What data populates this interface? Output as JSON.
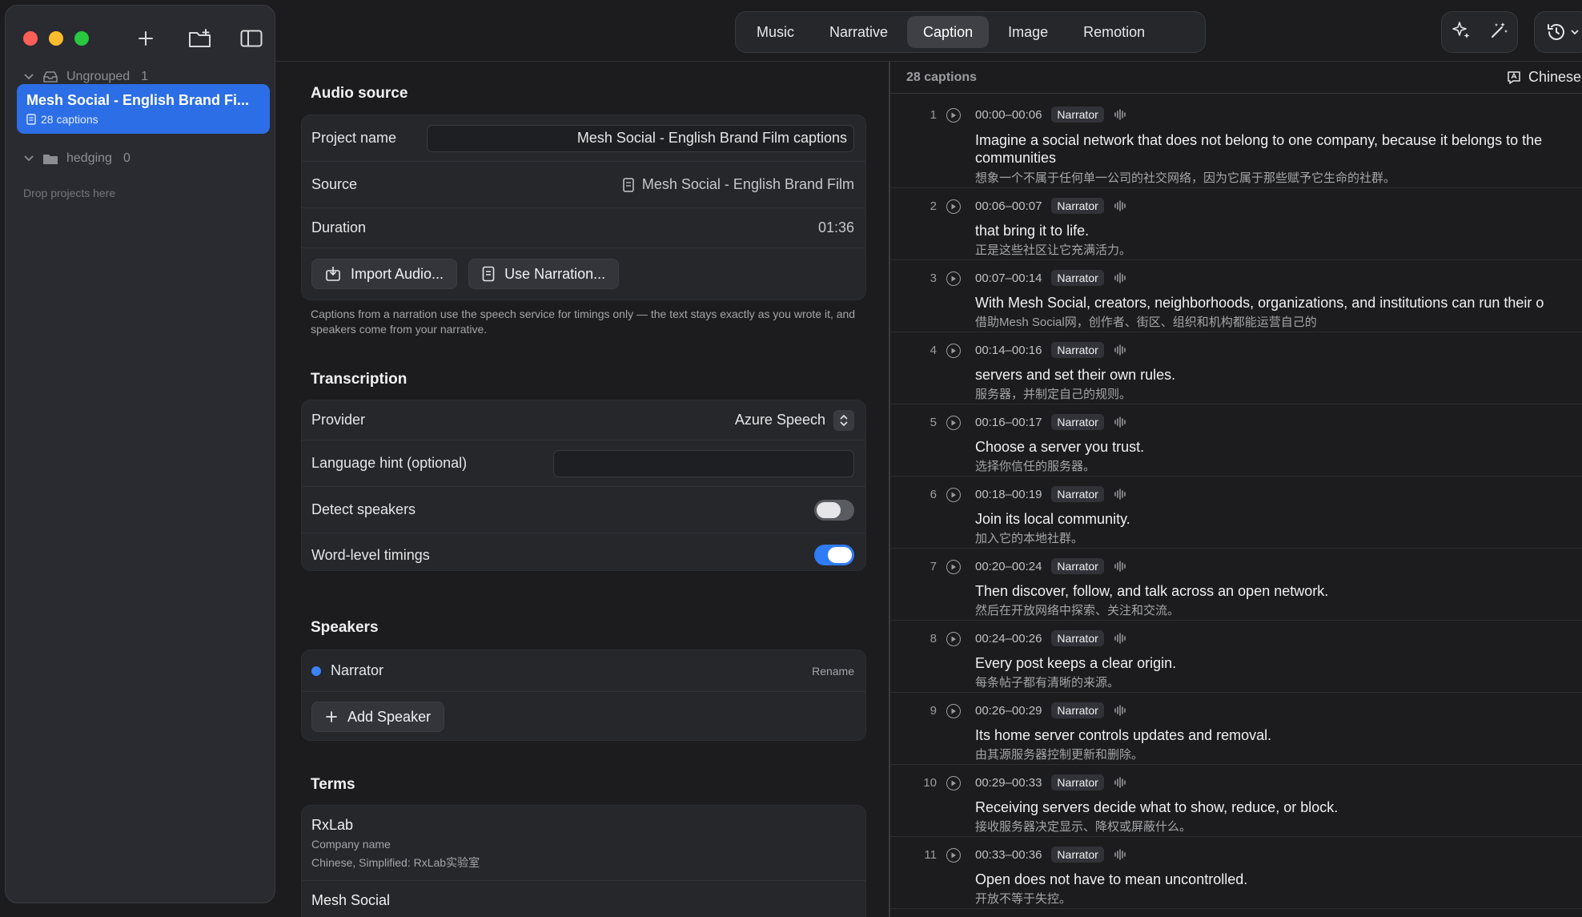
{
  "sidebar": {
    "groups": [
      {
        "name": "Ungrouped",
        "count": "1"
      },
      {
        "name": "hedging",
        "count": "0"
      }
    ],
    "project": {
      "title": "Mesh Social - English Brand Fi...",
      "subtitle": "28 captions"
    },
    "drop_hint": "Drop projects here"
  },
  "toolbar": {
    "tabs": [
      {
        "label": "Music"
      },
      {
        "label": "Narrative"
      },
      {
        "label": "Caption"
      },
      {
        "label": "Image"
      },
      {
        "label": "Remotion"
      }
    ],
    "active_tab": "Caption"
  },
  "audio": {
    "title": "Audio source",
    "project_name_label": "Project name",
    "project_name_value": "Mesh Social - English Brand Film captions",
    "source_label": "Source",
    "source_value": "Mesh Social - English Brand Film",
    "duration_label": "Duration",
    "duration_value": "01:36",
    "import_button": "Import Audio...",
    "narration_button": "Use Narration...",
    "note": "Captions from a narration use the speech service for timings only — the text stays exactly as you wrote it, and speakers come from your narrative."
  },
  "transcription": {
    "title": "Transcription",
    "provider_label": "Provider",
    "provider_value": "Azure Speech",
    "language_label": "Language hint (optional)",
    "language_value": "",
    "detect_label": "Detect speakers",
    "detect_on": false,
    "word_label": "Word-level timings",
    "word_on": true
  },
  "speakers": {
    "title": "Speakers",
    "items": [
      {
        "name": "Narrator",
        "color": "#3b82f6",
        "action": "Rename"
      }
    ],
    "add_button": "Add Speaker"
  },
  "terms": {
    "title": "Terms",
    "items": [
      {
        "name": "RxLab",
        "type": "Company name",
        "translation": "Chinese, Simplified: RxLab实验室"
      },
      {
        "name": "Mesh Social"
      }
    ]
  },
  "captions": {
    "count_label": "28 captions",
    "language": "Chinese, Sim",
    "items": [
      {
        "n": "1",
        "time": "00:00–00:06",
        "speaker": "Narrator",
        "text": [
          "Imagine a social network that does not belong to one company, because it belongs to the",
          "communities"
        ],
        "zh": "想象一个不属于任何单一公司的社交网络，因为它属于那些赋予它生命的社群。"
      },
      {
        "n": "2",
        "time": "00:06–00:07",
        "speaker": "Narrator",
        "text": [
          "that bring it to life."
        ],
        "zh": "正是这些社区让它充满活力。"
      },
      {
        "n": "3",
        "time": "00:07–00:14",
        "speaker": "Narrator",
        "text": [
          "With Mesh Social, creators, neighborhoods, organizations, and institutions can run their o"
        ],
        "zh": "借助Mesh Social网，创作者、街区、组织和机构都能运营自己的"
      },
      {
        "n": "4",
        "time": "00:14–00:16",
        "speaker": "Narrator",
        "text": [
          "servers and set their own rules."
        ],
        "zh": "服务器，并制定自己的规则。"
      },
      {
        "n": "5",
        "time": "00:16–00:17",
        "speaker": "Narrator",
        "text": [
          "Choose a server you trust."
        ],
        "zh": "选择你信任的服务器。"
      },
      {
        "n": "6",
        "time": "00:18–00:19",
        "speaker": "Narrator",
        "text": [
          "Join its local community."
        ],
        "zh": "加入它的本地社群。"
      },
      {
        "n": "7",
        "time": "00:20–00:24",
        "speaker": "Narrator",
        "text": [
          "Then discover, follow, and talk across an open network."
        ],
        "zh": "然后在开放网络中探索、关注和交流。"
      },
      {
        "n": "8",
        "time": "00:24–00:26",
        "speaker": "Narrator",
        "text": [
          "Every post keeps a clear origin."
        ],
        "zh": "每条帖子都有清晰的来源。"
      },
      {
        "n": "9",
        "time": "00:26–00:29",
        "speaker": "Narrator",
        "text": [
          "Its home server controls updates and removal."
        ],
        "zh": "由其源服务器控制更新和删除。"
      },
      {
        "n": "10",
        "time": "00:29–00:33",
        "speaker": "Narrator",
        "text": [
          "Receiving servers decide what to show, reduce, or block."
        ],
        "zh": "接收服务器决定显示、降权或屏蔽什么。"
      },
      {
        "n": "11",
        "time": "00:33–00:36",
        "speaker": "Narrator",
        "text": [
          "Open does not have to mean uncontrolled."
        ],
        "zh": "开放不等于失控。"
      }
    ]
  }
}
